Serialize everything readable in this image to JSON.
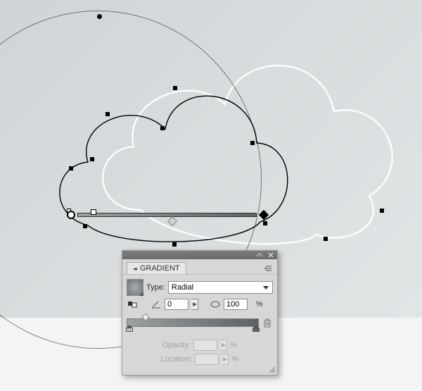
{
  "panel": {
    "title": "GRADIENT",
    "type_label": "Type:",
    "type_value": "Radial",
    "angle_value": "0",
    "aspect_value": "100",
    "aspect_suffix": "%",
    "opacity_label": "Opacity:",
    "opacity_suffix": "%",
    "location_label": "Location:",
    "location_suffix": "%"
  },
  "icons": {
    "collapse": "collapse-icon",
    "close": "close-icon",
    "panel_menu": "panel-menu-icon",
    "reverse": "reverse-gradient-icon",
    "angle": "angle-icon",
    "aspect": "aspect-ratio-icon",
    "trash": "trash-icon",
    "stepper": "stepper-icon",
    "dropdown": "dropdown-caret-icon",
    "resize": "resize-grip-icon",
    "tab_carets": "tab-collapse-carets-icon"
  },
  "colors": {
    "panel_bg": "#d7d7d7",
    "gradient_start": "#9ea1a2",
    "gradient_end": "#5e6163"
  }
}
